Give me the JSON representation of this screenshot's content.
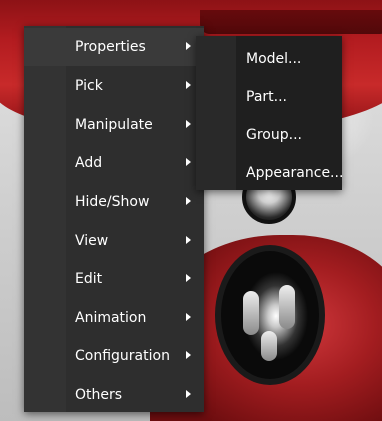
{
  "context_menu": {
    "items": [
      {
        "label": "Properties",
        "has_submenu": true
      },
      {
        "label": "Pick",
        "has_submenu": true
      },
      {
        "label": "Manipulate",
        "has_submenu": true
      },
      {
        "label": "Add",
        "has_submenu": true
      },
      {
        "label": "Hide/Show",
        "has_submenu": true
      },
      {
        "label": "View",
        "has_submenu": true
      },
      {
        "label": "Edit",
        "has_submenu": true
      },
      {
        "label": "Animation",
        "has_submenu": true
      },
      {
        "label": "Configuration",
        "has_submenu": true
      },
      {
        "label": "Others",
        "has_submenu": true
      }
    ],
    "active_item": "Properties",
    "submenu_arrow_icon": "chevron-right-icon"
  },
  "properties_submenu": {
    "items": [
      {
        "label": "Model..."
      },
      {
        "label": "Part..."
      },
      {
        "label": "Group..."
      },
      {
        "label": "Appearance..."
      }
    ]
  },
  "colors": {
    "menu_background": "#2e2e2e",
    "submenu_background": "#1f1f1f",
    "menu_text": "#ffffff",
    "car_paint": "#b31c20"
  }
}
